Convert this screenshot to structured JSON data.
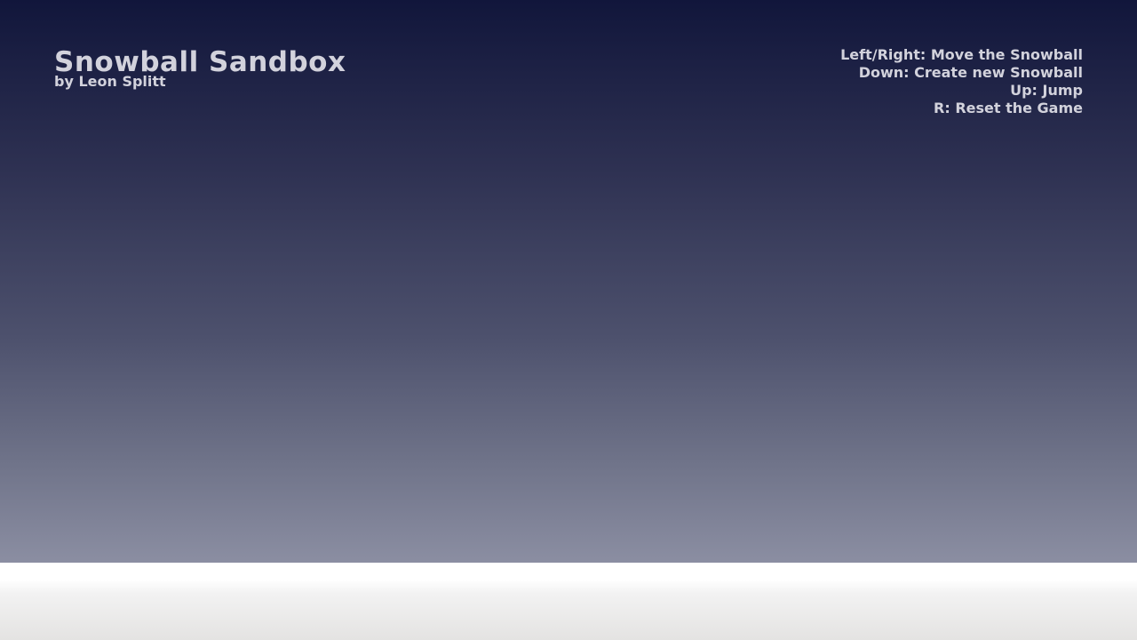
{
  "game": {
    "title": "Snowball Sandbox",
    "author": "by Leon Splitt"
  },
  "controls": {
    "lines": [
      "Left/Right: Move the Snowball",
      "Down: Create new Snowball",
      "Up: Jump",
      "R: Reset the Game"
    ]
  },
  "colors": {
    "sky_top": "#11163b",
    "sky_bottom": "#8b8ea2",
    "ground": "#ffffff",
    "text": "#d2d2dc"
  }
}
